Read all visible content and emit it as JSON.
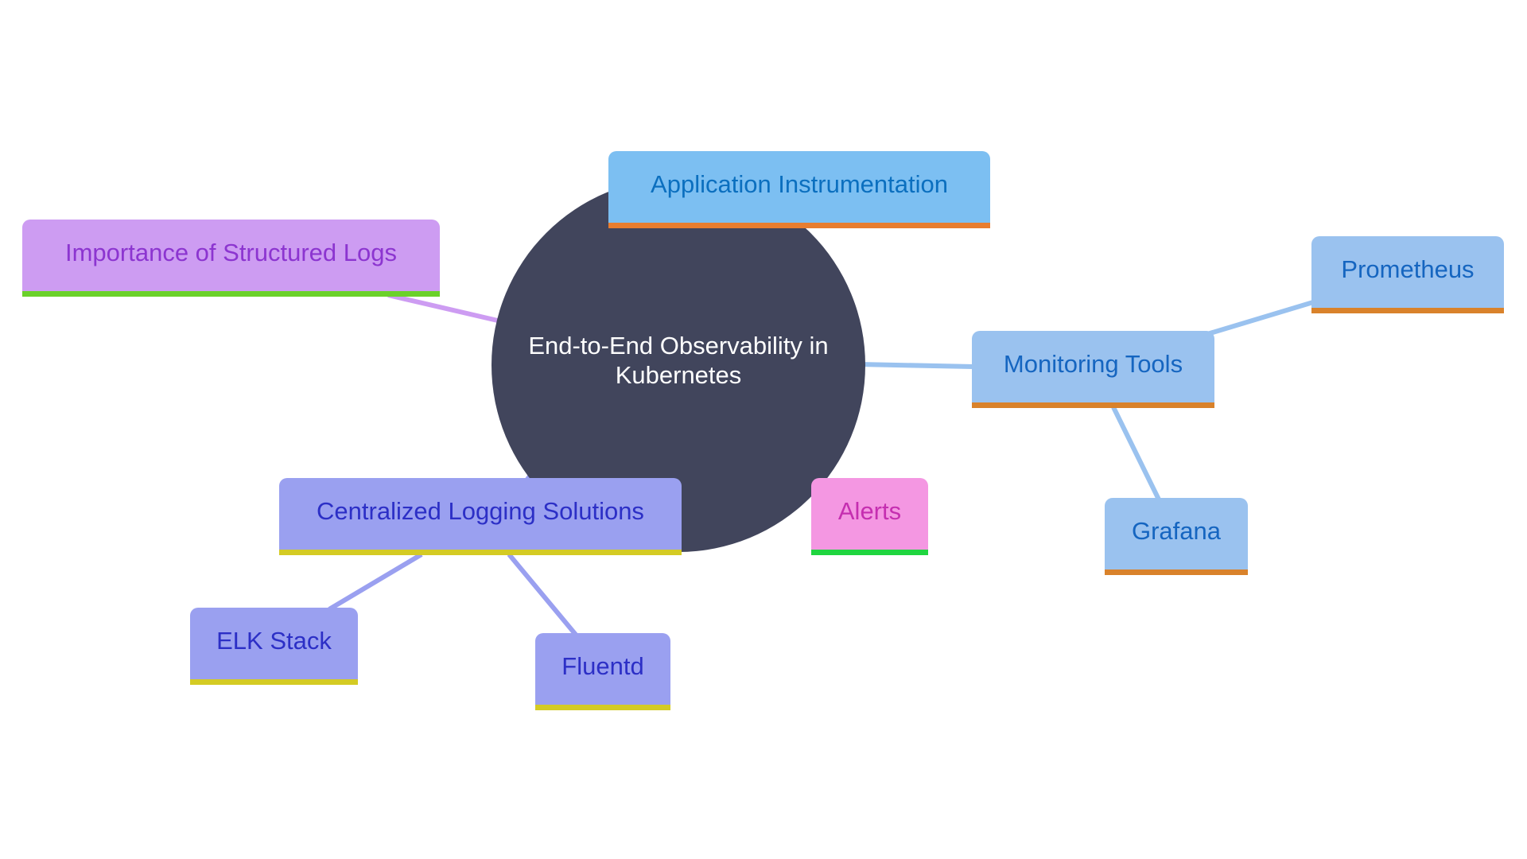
{
  "diagram": {
    "type": "mindmap",
    "root": {
      "label": "End-to-End Observability in Kubernetes",
      "fill": "#41455c",
      "text_color": "#ffffff"
    },
    "nodes": [
      {
        "id": "importance",
        "label": "Importance of Structured Logs",
        "parent": "root",
        "fill": "#cd9cf2",
        "text_color": "#8c35d0",
        "bar_color": "#6bd12a",
        "edge_color": "#cd9cf2"
      },
      {
        "id": "app",
        "label": "Application Instrumentation",
        "parent": "root",
        "fill": "#7cbff2",
        "text_color": "#0b6fbf",
        "bar_color": "#e87d2f",
        "edge_color": "#7cbff2"
      },
      {
        "id": "monitor",
        "label": "Monitoring Tools",
        "parent": "root",
        "fill": "#9ac2ef",
        "text_color": "#1565c0",
        "bar_color": "#d9822b",
        "edge_color": "#9ac2ef"
      },
      {
        "id": "prom",
        "label": "Prometheus",
        "parent": "monitor",
        "fill": "#9ac2ef",
        "text_color": "#1565c0",
        "bar_color": "#d9822b",
        "edge_color": "#9ac2ef"
      },
      {
        "id": "grafana",
        "label": "Grafana",
        "parent": "monitor",
        "fill": "#9ac2ef",
        "text_color": "#1565c0",
        "bar_color": "#d9822b",
        "edge_color": "#9ac2ef"
      },
      {
        "id": "alerts",
        "label": "Alerts",
        "parent": "root",
        "fill": "#f497e2",
        "text_color": "#c52eb0",
        "bar_color": "#20d540",
        "edge_color": "#f497e2"
      },
      {
        "id": "central",
        "label": "Centralized Logging Solutions",
        "parent": "root",
        "fill": "#9aa0f0",
        "text_color": "#2c2fc6",
        "bar_color": "#d4cb24",
        "edge_color": "#9aa0f0"
      },
      {
        "id": "elk",
        "label": "ELK Stack",
        "parent": "central",
        "fill": "#9aa0f0",
        "text_color": "#2c2fc6",
        "bar_color": "#d4cb24",
        "edge_color": "#9aa0f0"
      },
      {
        "id": "fluentd",
        "label": "Fluentd",
        "parent": "central",
        "fill": "#9aa0f0",
        "text_color": "#2c2fc6",
        "bar_color": "#d4cb24",
        "edge_color": "#9aa0f0"
      }
    ]
  }
}
